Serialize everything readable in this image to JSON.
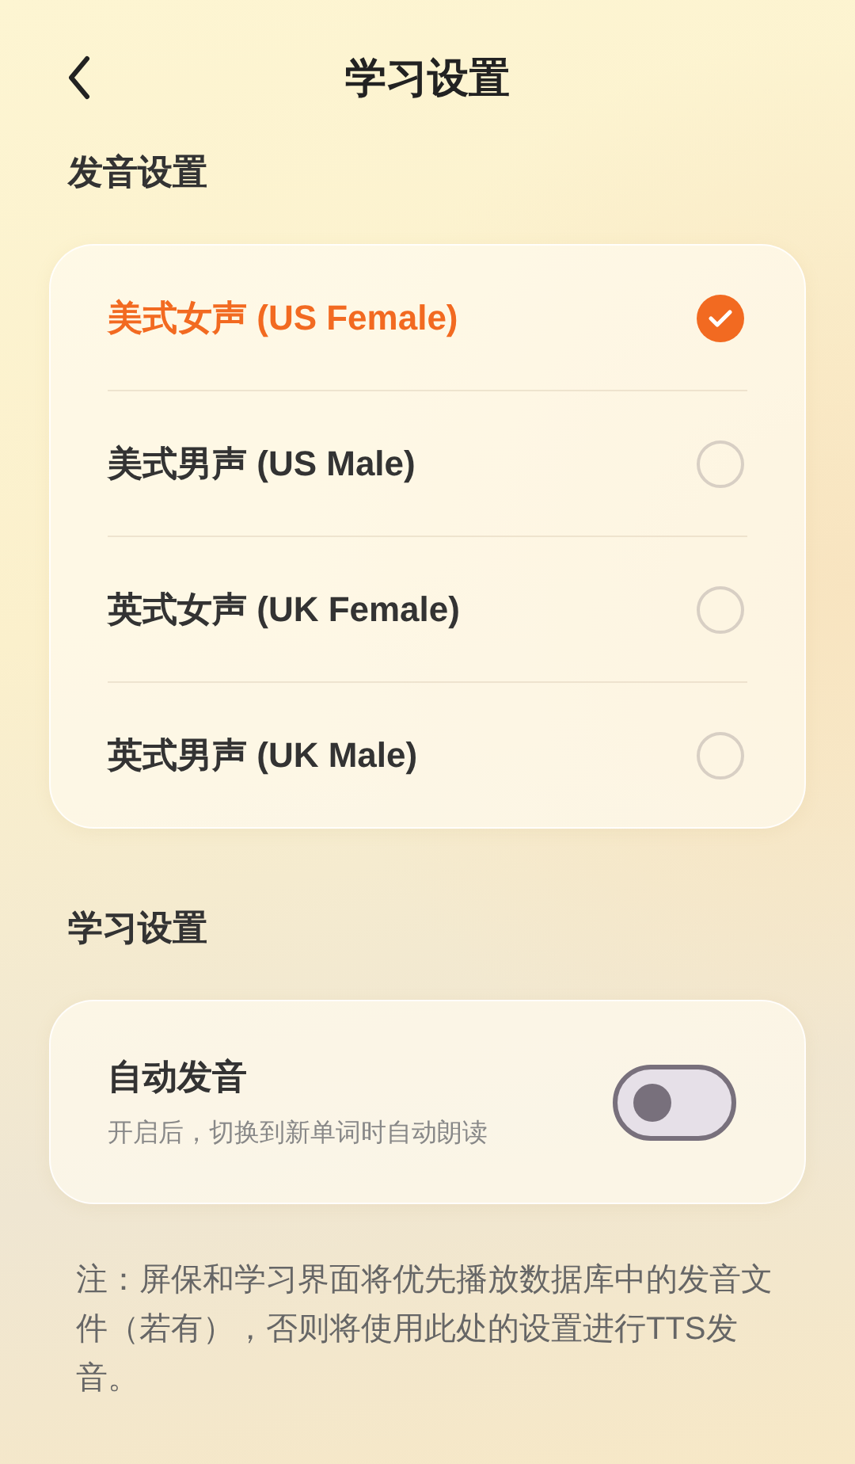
{
  "header": {
    "title": "学习设置"
  },
  "voice_section": {
    "title": "发音设置",
    "options": [
      {
        "label": "美式女声 (US Female)",
        "selected": true
      },
      {
        "label": "美式男声 (US Male)",
        "selected": false
      },
      {
        "label": "英式女声 (UK Female)",
        "selected": false
      },
      {
        "label": "英式男声 (UK Male)",
        "selected": false
      }
    ]
  },
  "study_section": {
    "title": "学习设置",
    "settings": [
      {
        "label": "自动发音",
        "description": "开启后，切换到新单词时自动朗读",
        "on": false
      }
    ]
  },
  "note": "注：屏保和学习界面将优先播放数据库中的发音文件（若有），否则将使用此处的设置进行TTS发音。"
}
